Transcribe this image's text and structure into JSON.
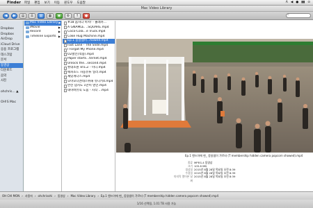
{
  "menubar": {
    "apple": "",
    "app": "Finder",
    "items": [
      "파일",
      "편집",
      "보기",
      "이동",
      "윈도우",
      "도움말"
    ],
    "right": [
      "A",
      "◀",
      "●",
      "▮▮",
      "⊙"
    ]
  },
  "window": {
    "title": "Mac Video Library"
  },
  "toolbar": {
    "back": "◀",
    "forward": "▶",
    "view_icon": "▤",
    "view_list": "☰",
    "view_columns": "▥",
    "view_cover": "▦",
    "quicklook": "◉",
    "arrange": "⚙",
    "action": "↑",
    "share": "●",
    "search_placeholder": ""
  },
  "sidebar": {
    "items": [
      {
        "label": "Dropbox",
        "selected": false
      },
      {
        "label": "Dropbox",
        "selected": false
      },
      {
        "label": "AirDrop",
        "selected": false
      },
      {
        "label": "iCloud Drive",
        "selected": false
      },
      {
        "label": "응용 프로그램",
        "selected": false
      },
      {
        "label": "데스크탑",
        "selected": false
      },
      {
        "label": "문서",
        "selected": false
      },
      {
        "label": "동영상",
        "selected": true
      },
      {
        "label": "다운로드",
        "selected": false
      },
      {
        "label": "음악",
        "selected": false
      },
      {
        "label": "사진",
        "selected": false
      },
      {
        "label": "",
        "selected": false
      },
      {
        "label": "ohchris... ▲",
        "selected": false
      },
      {
        "label": "",
        "selected": false
      },
      {
        "label": "",
        "selected": false
      },
      {
        "label": "OH!S Mac",
        "selected": false
      }
    ]
  },
  "col1": {
    "items": [
      {
        "label": "Mac Video Library",
        "selected": true
      },
      {
        "label": "iMovie",
        "selected": false
      },
      {
        "label": "Record",
        "selected": false
      },
      {
        "label": "Timeline Exports",
        "selected": false
      }
    ]
  },
  "col2": {
    "items": [
      {
        "label": "#18 움치다 아저! - 몰래카...",
        "selected": false
      },
      {
        "label": "A GNAMLE. ..SQUARE.mp4",
        "selected": false
      },
      {
        "label": "Coca-Cola...e Truck.mp4",
        "selected": false
      },
      {
        "label": "Coke Hug Machine.mp4",
        "selected": false
      },
      {
        "label": "Ep.1 옹달샘어...howed.mp4",
        "selected": true
      },
      {
        "label": "Fast Lane - The Slide.mp4",
        "selected": false
      },
      {
        "label": "I Forgot My Phone.mp4",
        "selected": false
      },
      {
        "label": "O2할인(적용).mp4",
        "selected": false
      },
      {
        "label": "Paper starts...ternet.mp4",
        "selected": false
      },
      {
        "label": "Unlock the...second.mp4",
        "selected": false
      },
      {
        "label": "롯데소원 로또고 - 미니.mp4",
        "selected": false
      },
      {
        "label": "애피소드 자동유튜 일러.mp4",
        "selected": false
      },
      {
        "label": "재밌게다스.mp4",
        "selected": false
      },
      {
        "label": "모아모니엔테스위해 유니키4.mp4",
        "selected": false
      },
      {
        "label": "반전 넘치도 1만이 영인.mp4",
        "selected": false
      },
      {
        "label": "네이버뮤직 도움 - 시작 ...mp4",
        "selected": false
      }
    ]
  },
  "preview": {
    "file_title": "Ep.1 엔드아에 현_ 옹달샘이 갸르타 (T membership hidden camera popcorn showed).mp4",
    "info": [
      {
        "key": "종류",
        "value": "MPEG-4 동영상"
      },
      {
        "key": "크기",
        "value": "105.8 MB"
      },
      {
        "key": "생성일",
        "value": "2015년 8월 28일 목요일 오전 8:39"
      },
      {
        "key": "수정일",
        "value": "2015년 8월 28일 목요일 오전 8:39"
      },
      {
        "key": "마지막 열어본 날짜",
        "value": "2015년 8월 28일 목요일 오전 8:39"
      },
      {
        "key": "",
        "value": ""
      },
      {
        "key": "",
        "value": ""
      }
    ]
  },
  "pathbar": {
    "items": [
      "OH CHI MON",
      "사용자",
      "ohchrisohi",
      "동영상",
      "Mac Video Library",
      "Ep.1 엔드아에 현_ 옹달샘이 갸르타 (T membership hidden camera popcorn showed).mp4"
    ]
  },
  "status": {
    "text": "1/16 선택됨, 1.01 TB 사용 가능"
  }
}
